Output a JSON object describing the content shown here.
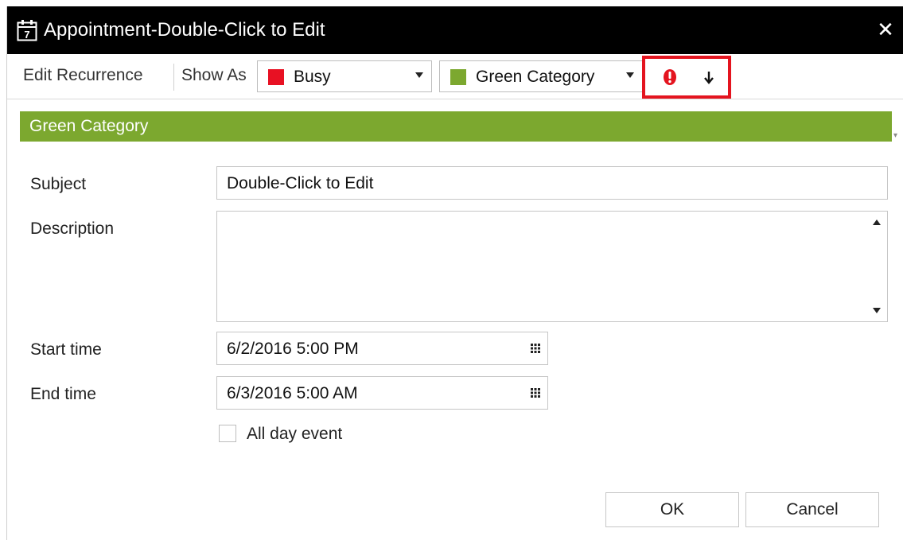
{
  "window": {
    "title": "Appointment-Double-Click to Edit",
    "close_glyph": "✕",
    "title_icon": "calendar-icon",
    "day_number": "7"
  },
  "toolbar": {
    "edit_recurrence": "Edit Recurrence",
    "show_as_label": "Show As",
    "show_as_value": "Busy",
    "show_as_color": "#e81123",
    "category_value": "Green Category",
    "category_color": "#7ca82f",
    "high_importance_icon": "exclamation-icon",
    "high_importance_color": "#e4141f",
    "low_importance_icon": "down-arrow-icon",
    "highlight_color": "#e4141f",
    "overflow_glyph": "▾"
  },
  "category_bar": {
    "label": "Green Category",
    "color": "#7ca82f"
  },
  "form": {
    "subject_label": "Subject",
    "subject_value": "Double-Click to Edit",
    "description_label": "Description",
    "description_value": "",
    "start_label": "Start time",
    "start_value": "6/2/2016 5:00 PM",
    "end_label": "End time",
    "end_value": "6/3/2016 5:00 AM",
    "all_day_label": "All day event",
    "all_day_checked": false
  },
  "buttons": {
    "ok": "OK",
    "cancel": "Cancel"
  }
}
